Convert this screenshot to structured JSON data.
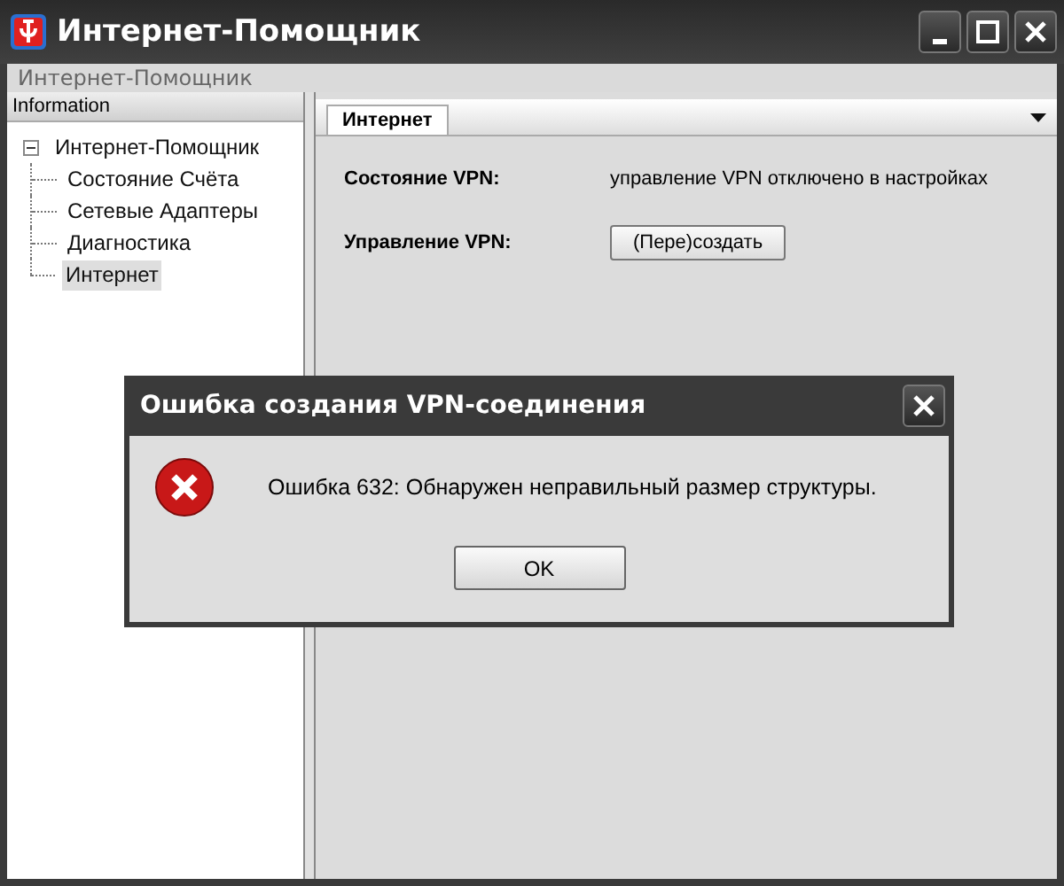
{
  "window": {
    "title": "Интернет-Помощник"
  },
  "menu_bar": {
    "label": "Интернет-Помощник"
  },
  "sidebar": {
    "header": "Information",
    "tree": [
      {
        "label": "Интернет-Помощник",
        "expanded": true,
        "selected": false,
        "children": [
          {
            "label": "Состояние Счёта",
            "selected": false
          },
          {
            "label": "Сетевые Адаптеры",
            "selected": false
          },
          {
            "label": "Диагностика",
            "selected": false
          },
          {
            "label": "Интернет",
            "selected": true
          }
        ]
      }
    ]
  },
  "tabs": [
    {
      "label": "Интернет",
      "selected": true
    }
  ],
  "vpn": {
    "status_label": "Состояние VPN:",
    "status_value": "управление VPN отключено в настройках",
    "control_label": "Управление VPN:",
    "button": "(Пере)создать"
  },
  "dialog": {
    "title": "Ошибка создания VPN-соединения",
    "message": "Ошибка 632: Обнаружен неправильный размер структуры.",
    "button": "OK"
  }
}
